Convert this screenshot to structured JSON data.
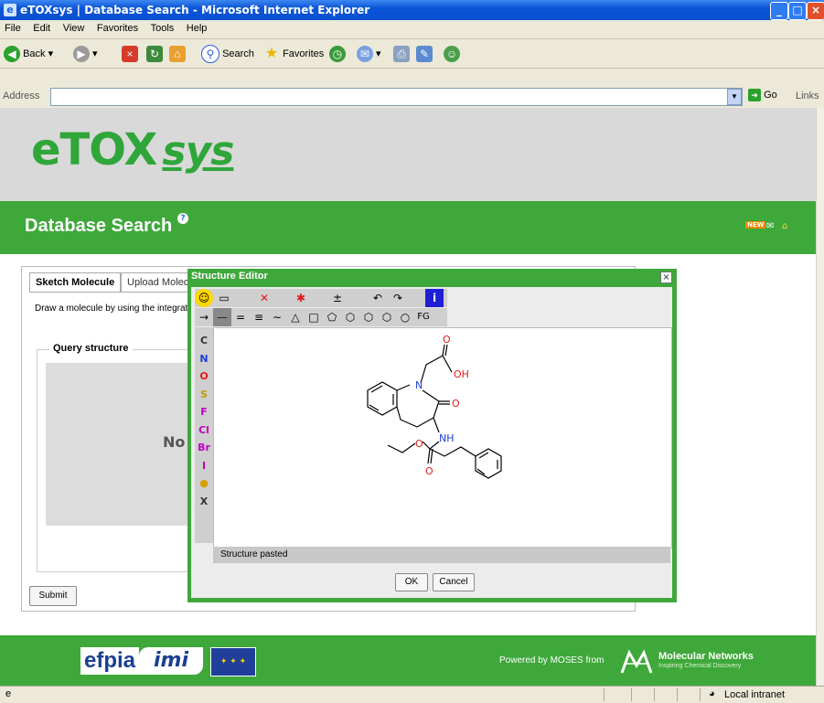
{
  "window": {
    "title": "eTOXsys | Database Search - Microsoft Internet Explorer",
    "buttons": [
      "minimize",
      "maximize",
      "close"
    ]
  },
  "menu": [
    "File",
    "Edit",
    "View",
    "Favorites",
    "Tools",
    "Help"
  ],
  "toolbar": {
    "back": "Back",
    "search": "Search",
    "favorites": "Favorites"
  },
  "address": {
    "label": "Address",
    "value": "",
    "go": "Go",
    "links": "Links"
  },
  "header": {
    "logo_main": "eTOX",
    "logo_sys": "sys"
  },
  "page": {
    "title": "Database Search",
    "help_symbol": "?",
    "header_icons": [
      "NEW",
      "✉",
      "⌂"
    ]
  },
  "tabs": [
    {
      "label": "Sketch Molecule",
      "active": true
    },
    {
      "label": "Upload Molecule",
      "active": false
    }
  ],
  "panel": {
    "instruction": "Draw a molecule by using the integrate",
    "query_legend": "Query structure",
    "no_structure": "No",
    "submit": "Submit"
  },
  "dialog": {
    "title": "Structure Editor",
    "close": "×",
    "status": "Structure pasted",
    "ok": "OK",
    "cancel": "Cancel",
    "toolbar_row1": [
      "☺",
      "▭",
      "",
      "✕",
      "",
      "✱",
      "",
      "±",
      "",
      "↶",
      "↷",
      "",
      "i"
    ],
    "toolbar_row2": [
      "→",
      "—",
      "=",
      "≡",
      "∼",
      "△",
      "□",
      "⬠",
      "⬡",
      "⬡",
      "⬡",
      "○",
      "FG"
    ],
    "atoms": [
      {
        "symbol": "C",
        "color": "#333333"
      },
      {
        "symbol": "N",
        "color": "#1f3fd6"
      },
      {
        "symbol": "O",
        "color": "#e01b1b"
      },
      {
        "symbol": "S",
        "color": "#b8a000"
      },
      {
        "symbol": "F",
        "color": "#c000c0"
      },
      {
        "symbol": "Cl",
        "color": "#c000c0"
      },
      {
        "symbol": "Br",
        "color": "#c000c0"
      },
      {
        "symbol": "I",
        "color": "#c000c0"
      },
      {
        "symbol": "",
        "color": "#d4a000"
      },
      {
        "symbol": "X",
        "color": "#333333"
      }
    ],
    "molecule_labels": {
      "n_ring": "N",
      "oh": "OH",
      "o_acid": "O",
      "o_lactam": "O",
      "nh": "NH",
      "o_ester": "O",
      "o_carbonyl": "O"
    }
  },
  "footer": {
    "efpia": "efpia",
    "imi": "imi",
    "powered_by": "Powered by MOSES from",
    "company": "Molecular Networks",
    "tagline": "Inspiring Chemical Discovery"
  },
  "status_bar": {
    "zone": "Local intranet"
  },
  "colors": {
    "brand_green": "#3ea83a",
    "xp_blue": "#0b55d8"
  }
}
